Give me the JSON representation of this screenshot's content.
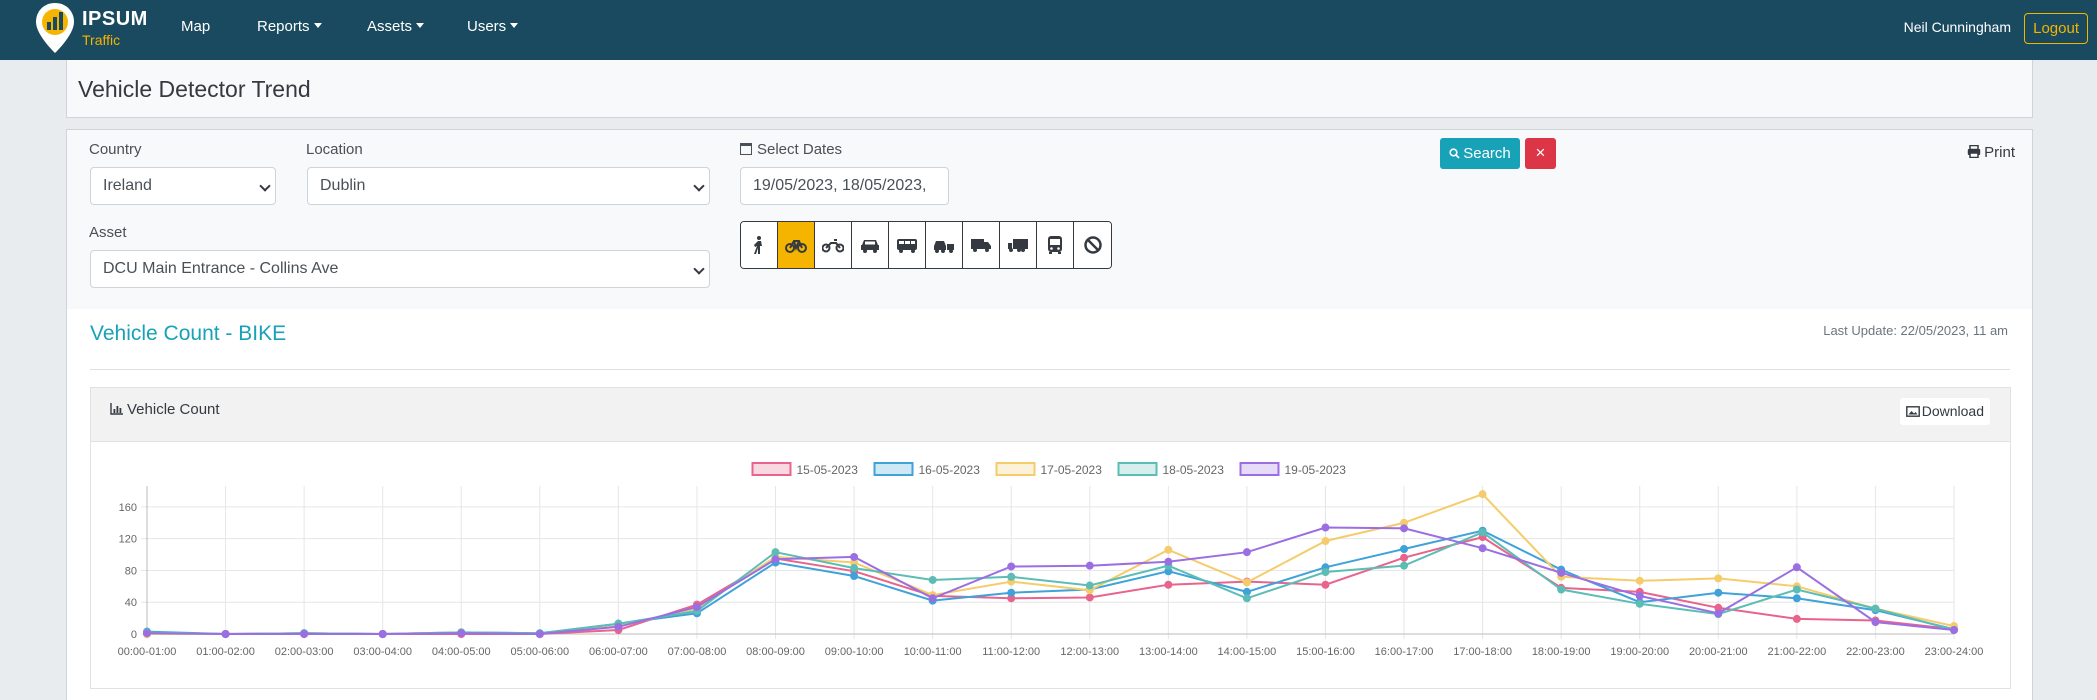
{
  "brand": {
    "name": "IPSUM",
    "sub": "Traffic"
  },
  "nav": {
    "map": "Map",
    "reports": "Reports",
    "assets": "Assets",
    "users": "Users",
    "user_name": "Neil Cunningham",
    "logout": "Logout"
  },
  "page": {
    "title": "Vehicle Detector Trend"
  },
  "filters": {
    "country_label": "Country",
    "country_value": "Ireland",
    "location_label": "Location",
    "location_value": "Dublin",
    "asset_label": "Asset",
    "asset_value": "DCU Main Entrance - Collins Ave",
    "dates_label": "Select Dates",
    "dates_value": "19/05/2023, 18/05/2023,",
    "search_label": "Search",
    "clear_label": "×",
    "print_label": "Print",
    "vehicle_types": [
      {
        "icon": "pedestrian-icon",
        "active": false
      },
      {
        "icon": "bicycle-icon",
        "active": true
      },
      {
        "icon": "motorcycle-icon",
        "active": false
      },
      {
        "icon": "car-icon",
        "active": false
      },
      {
        "icon": "van-icon",
        "active": false
      },
      {
        "icon": "car-trailer-icon",
        "active": false
      },
      {
        "icon": "truck-icon",
        "active": false
      },
      {
        "icon": "lorry-icon",
        "active": false
      },
      {
        "icon": "bus-icon",
        "active": false
      },
      {
        "icon": "none-icon",
        "active": false
      }
    ]
  },
  "count": {
    "title": "Vehicle Count - BIKE",
    "last_update": "Last Update: 22/05/2023, 11 am",
    "chart_title": "Vehicle Count",
    "download_label": "Download"
  },
  "colors": {
    "accent": "#17a2b8",
    "brand": "#f4b400",
    "navbar": "#1a4a5f",
    "danger": "#dc3545"
  },
  "chart_data": {
    "type": "line",
    "title": "Vehicle Count",
    "xlabel": "",
    "ylabel": "",
    "ylim": [
      0,
      180
    ],
    "yticks": [
      0,
      40,
      80,
      120,
      160
    ],
    "grid": true,
    "legend_position": "top",
    "categories": [
      "00:00-01:00",
      "01:00-02:00",
      "02:00-03:00",
      "03:00-04:00",
      "04:00-05:00",
      "05:00-06:00",
      "06:00-07:00",
      "07:00-08:00",
      "08:00-09:00",
      "09:00-10:00",
      "10:00-11:00",
      "11:00-12:00",
      "12:00-13:00",
      "13:00-14:00",
      "14:00-15:00",
      "15:00-16:00",
      "16:00-17:00",
      "17:00-18:00",
      "18:00-19:00",
      "19:00-20:00",
      "20:00-21:00",
      "21:00-22:00",
      "22:00-23:00",
      "23:00-24:00"
    ],
    "series": [
      {
        "name": "15-05-2023",
        "color": "#e8648c",
        "values": [
          0,
          0,
          1,
          0,
          0,
          0,
          5,
          37,
          95,
          79,
          48,
          45,
          46,
          62,
          66,
          62,
          96,
          122,
          58,
          53,
          33,
          19,
          17,
          6
        ]
      },
      {
        "name": "16-05-2023",
        "color": "#3fa2d8",
        "values": [
          3,
          0,
          1,
          0,
          2,
          1,
          13,
          26,
          90,
          73,
          42,
          52,
          56,
          79,
          53,
          84,
          107,
          130,
          81,
          40,
          52,
          45,
          30,
          6
        ]
      },
      {
        "name": "17-05-2023",
        "color": "#f5cc6b",
        "values": [
          0,
          0,
          0,
          0,
          2,
          0,
          10,
          32,
          97,
          90,
          49,
          66,
          55,
          106,
          65,
          117,
          140,
          176,
          72,
          67,
          70,
          60,
          32,
          10
        ]
      },
      {
        "name": "18-05-2023",
        "color": "#5bbdb5",
        "values": [
          2,
          0,
          1,
          0,
          2,
          1,
          13,
          29,
          103,
          83,
          68,
          72,
          61,
          86,
          45,
          78,
          86,
          128,
          56,
          38,
          25,
          56,
          32,
          5
        ]
      },
      {
        "name": "19-05-2023",
        "color": "#9b6ee3",
        "values": [
          1,
          0,
          0,
          0,
          1,
          0,
          9,
          34,
          94,
          97,
          45,
          85,
          86,
          91,
          103,
          134,
          133,
          108,
          77,
          48,
          26,
          84,
          15,
          5
        ]
      }
    ]
  }
}
